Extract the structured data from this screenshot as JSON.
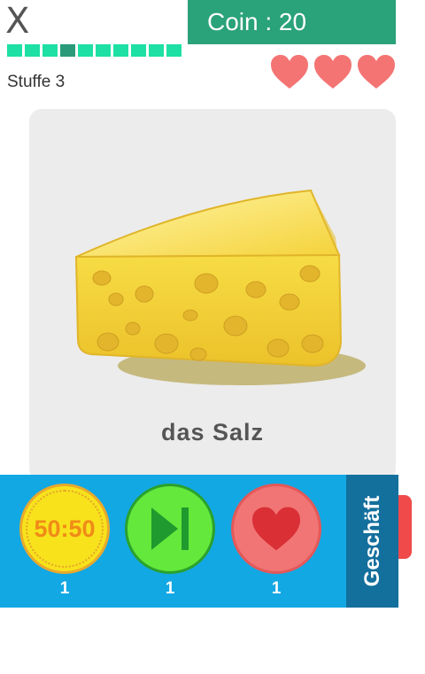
{
  "header": {
    "close_label": "X",
    "coin_label": "Coin : 20",
    "level_label": "Stuffe 3"
  },
  "progress": {
    "total_segments": 10,
    "current_segment": 4
  },
  "lives": {
    "count": 3,
    "icon": "heart-icon",
    "color": "#f47474"
  },
  "card": {
    "image": "cheese-image",
    "word": "das Salz"
  },
  "powerups": [
    {
      "id": "fifty-fifty",
      "label": "50:50",
      "count": "1",
      "icon": "fifty-fifty-icon"
    },
    {
      "id": "skip",
      "count": "1",
      "icon": "skip-icon"
    },
    {
      "id": "extra-life",
      "count": "1",
      "icon": "heart-icon"
    }
  ],
  "shop": {
    "label": "Geschäft"
  },
  "colors": {
    "coin_bg": "#2aa27a",
    "progress": "#1ee0a4",
    "bar_bg": "#12a8e4",
    "shop_bg": "#136f9c",
    "tab": "#f04a4a"
  }
}
